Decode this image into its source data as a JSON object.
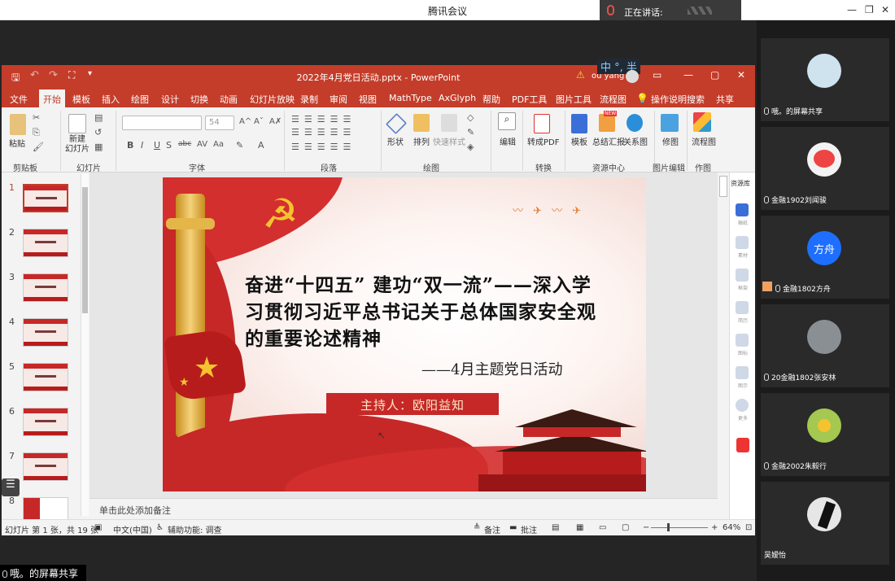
{
  "meeting": {
    "title": "腾讯会议",
    "speaking_label": "正在讲话:",
    "share_label": "哦。的屏幕共享"
  },
  "ppt": {
    "file_title": "2022年4月党日活动.pptx - PowerPoint",
    "user": "ou yang",
    "ime": "中 °, 半",
    "menu": [
      "文件",
      "开始",
      "模板",
      "插入",
      "绘图",
      "设计",
      "切换",
      "动画",
      "幻灯片放映",
      "录制",
      "审阅",
      "视图",
      "MathType",
      "AxGlyph",
      "帮助",
      "PDF工具",
      "图片工具",
      "流程图",
      "操作说明搜索",
      "共享"
    ],
    "ribbon": {
      "paste": "粘贴",
      "new_slide": "新建\n幻灯片",
      "font_size": "54",
      "shape": "形状",
      "arrange": "排列",
      "quick_style": "快速样式",
      "edit": "编辑",
      "to_pdf": "转成PDF",
      "template": "模板",
      "summary": "总结汇报",
      "relation": "关系图",
      "fix_img": "修图",
      "flow": "流程图",
      "new_badge": "NEW",
      "groups": [
        "剪贴板",
        "幻灯片",
        "字体",
        "段落",
        "绘图",
        "转换",
        "资源中心",
        "图片编辑",
        "作图"
      ]
    },
    "slides_count": [
      "1",
      "2",
      "3",
      "4",
      "5",
      "6",
      "7",
      "8"
    ],
    "slide": {
      "title": "奋进“十四五” 建功“双一流”——深入学习贯彻习近平总书记关于总体国家安全观的重要论述精神",
      "subtitle": "——4月主题党日活动",
      "host": "主持人：欧阳益知"
    },
    "resource_panel": {
      "title": "资源库",
      "items": [
        "稿纸",
        "素材",
        "框架",
        "简历",
        "图标",
        "图示",
        "更多"
      ]
    },
    "notes_placeholder": "单击此处添加备注",
    "status": {
      "slide_info": "幻灯片 第 1 张，共 19 张",
      "language": "中文(中国)",
      "accessibility": "辅助功能: 调查",
      "notes": "备注",
      "comments": "批注",
      "zoom": "64%"
    }
  },
  "participants": [
    {
      "name": "哦。的屏幕共享",
      "color": "#cfe3ef"
    },
    {
      "name": "金融1902刘闻骏",
      "color": "#f3f3f3"
    },
    {
      "name": "金融1802方舟",
      "avatar_text": "方舟",
      "color": "#1e6fff"
    },
    {
      "name": "20金融1802张安林",
      "color": "#8a8f93"
    },
    {
      "name": "金融2002朱毅行",
      "color": "#a5c850"
    },
    {
      "name": "吴嫒怡",
      "color": "#e6e6e6"
    }
  ]
}
